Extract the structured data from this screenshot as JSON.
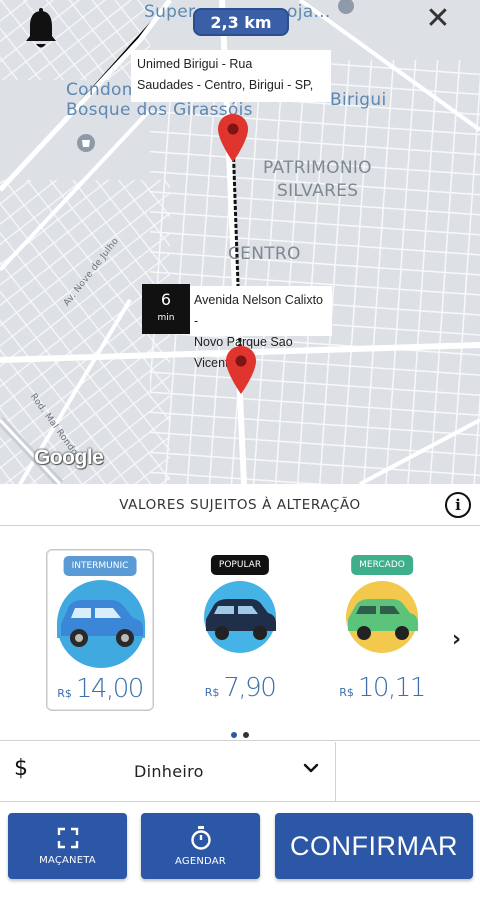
{
  "map": {
    "distance": "2,3 km",
    "labels": {
      "super": "Super",
      "oja": "oja...",
      "condom": "Condom",
      "bosque": "Bosque dos Girassóis",
      "birigui": "Birigui",
      "patrimonio": "PATRIMONIO",
      "silvares": "SILVARES",
      "centro": "CENTRO",
      "av_julho": "Av. Nove de Julho",
      "rod_mal": "Rod. Mal Rondon"
    },
    "origin_address": [
      "Unimed Birigui - Rua",
      "Saudades - Centro, Birigui - SP,"
    ],
    "destination_address": [
      "Avenida Nelson Calixto -",
      "Novo Parque Sao Vicente,"
    ],
    "eta": {
      "value": "6",
      "unit": "min"
    },
    "logo": "Google",
    "icons": [
      "bell-icon",
      "close-icon",
      "origin-pin-icon",
      "destination-pin-icon"
    ]
  },
  "notice": {
    "text": "VALORES SUJEITOS À ALTERAÇÃO",
    "icon": "info-icon"
  },
  "categories": [
    {
      "tag": "INTERMUNIC",
      "tag_color": "#5b9bd5",
      "currency": "R$",
      "price": "14,00",
      "selected": true,
      "car_color": "#3b86d6",
      "bg_color": "#3fa9e0"
    },
    {
      "tag": "POPULAR",
      "tag_color": "#111111",
      "currency": "R$",
      "price": "7,90",
      "selected": false,
      "car_color": "#1f2f4a",
      "bg_color": "#45b3e6"
    },
    {
      "tag": "MERCADO",
      "tag_color": "#3fae8a",
      "currency": "R$",
      "price": "10,11",
      "selected": false,
      "car_color": "#5bc37a",
      "bg_color": "#f2c94c"
    }
  ],
  "pagination": {
    "active": 0,
    "count": 2,
    "active_color": "#2c57a6",
    "inactive_color": "#333333"
  },
  "payment": {
    "symbol": "$",
    "method": "Dinheiro"
  },
  "actions": {
    "macaneta": "MAÇANETA",
    "agendar": "AGENDAR",
    "confirmar": "CONFIRMAR"
  },
  "colors": {
    "primary": "#2c57a6",
    "price": "#3c6fab",
    "pin": "#e0342e"
  }
}
